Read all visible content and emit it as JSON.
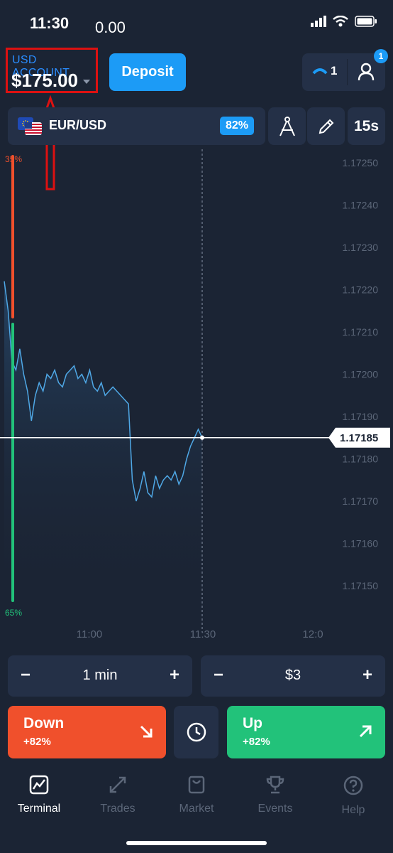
{
  "status_bar": {
    "time": "11:30",
    "value": "0.00"
  },
  "account": {
    "label": "USD ACCOUNT",
    "balance": "$175.00"
  },
  "deposit_label": "Deposit",
  "notifications": {
    "count": "1",
    "badge": "1"
  },
  "pair": {
    "name": "EUR/USD",
    "payout": "82%"
  },
  "timeframe": "15s",
  "chart_data": {
    "type": "line",
    "y_ticks": [
      "1.17250",
      "1.17240",
      "1.17230",
      "1.17220",
      "1.17210",
      "1.17200",
      "1.17190",
      "1.17180",
      "1.17170",
      "1.17160",
      "1.17150"
    ],
    "x_ticks": [
      "11:00",
      "11:30",
      "12:0"
    ],
    "current_price": "1.17185",
    "sentiment": {
      "down_pct": "35%",
      "up_pct": "65%"
    },
    "series_y": [
      1.17222,
      1.17215,
      1.17203,
      1.17201,
      1.17206,
      1.172,
      1.17196,
      1.17189,
      1.17195,
      1.17198,
      1.17196,
      1.172,
      1.17199,
      1.17201,
      1.17198,
      1.17197,
      1.172,
      1.17201,
      1.17202,
      1.17199,
      1.172,
      1.17198,
      1.17201,
      1.17197,
      1.17196,
      1.17198,
      1.17195,
      1.17196,
      1.17197,
      1.17196,
      1.17195,
      1.17194,
      1.17193,
      1.17175,
      1.1717,
      1.17173,
      1.17177,
      1.17172,
      1.17171,
      1.17176,
      1.17173,
      1.17175,
      1.17176,
      1.17175,
      1.17177,
      1.17174,
      1.17176,
      1.1718,
      1.17183,
      1.17185,
      1.17187,
      1.17185
    ]
  },
  "duration": {
    "value": "1 min",
    "minus": "−",
    "plus": "+"
  },
  "amount": {
    "value": "$3",
    "minus": "−",
    "plus": "+"
  },
  "down": {
    "label": "Down",
    "pct": "+82%"
  },
  "up": {
    "label": "Up",
    "pct": "+82%"
  },
  "nav": [
    {
      "label": "Terminal",
      "icon": "chart-icon"
    },
    {
      "label": "Trades",
      "icon": "arrows-icon"
    },
    {
      "label": "Market",
      "icon": "bag-icon"
    },
    {
      "label": "Events",
      "icon": "trophy-icon"
    },
    {
      "label": "Help",
      "icon": "help-icon"
    }
  ],
  "colors": {
    "bg": "#1b2434",
    "panel": "#243047",
    "accent": "#1c9bf6",
    "down": "#f0502c",
    "up": "#22c27a",
    "line": "#4fa8e6"
  }
}
